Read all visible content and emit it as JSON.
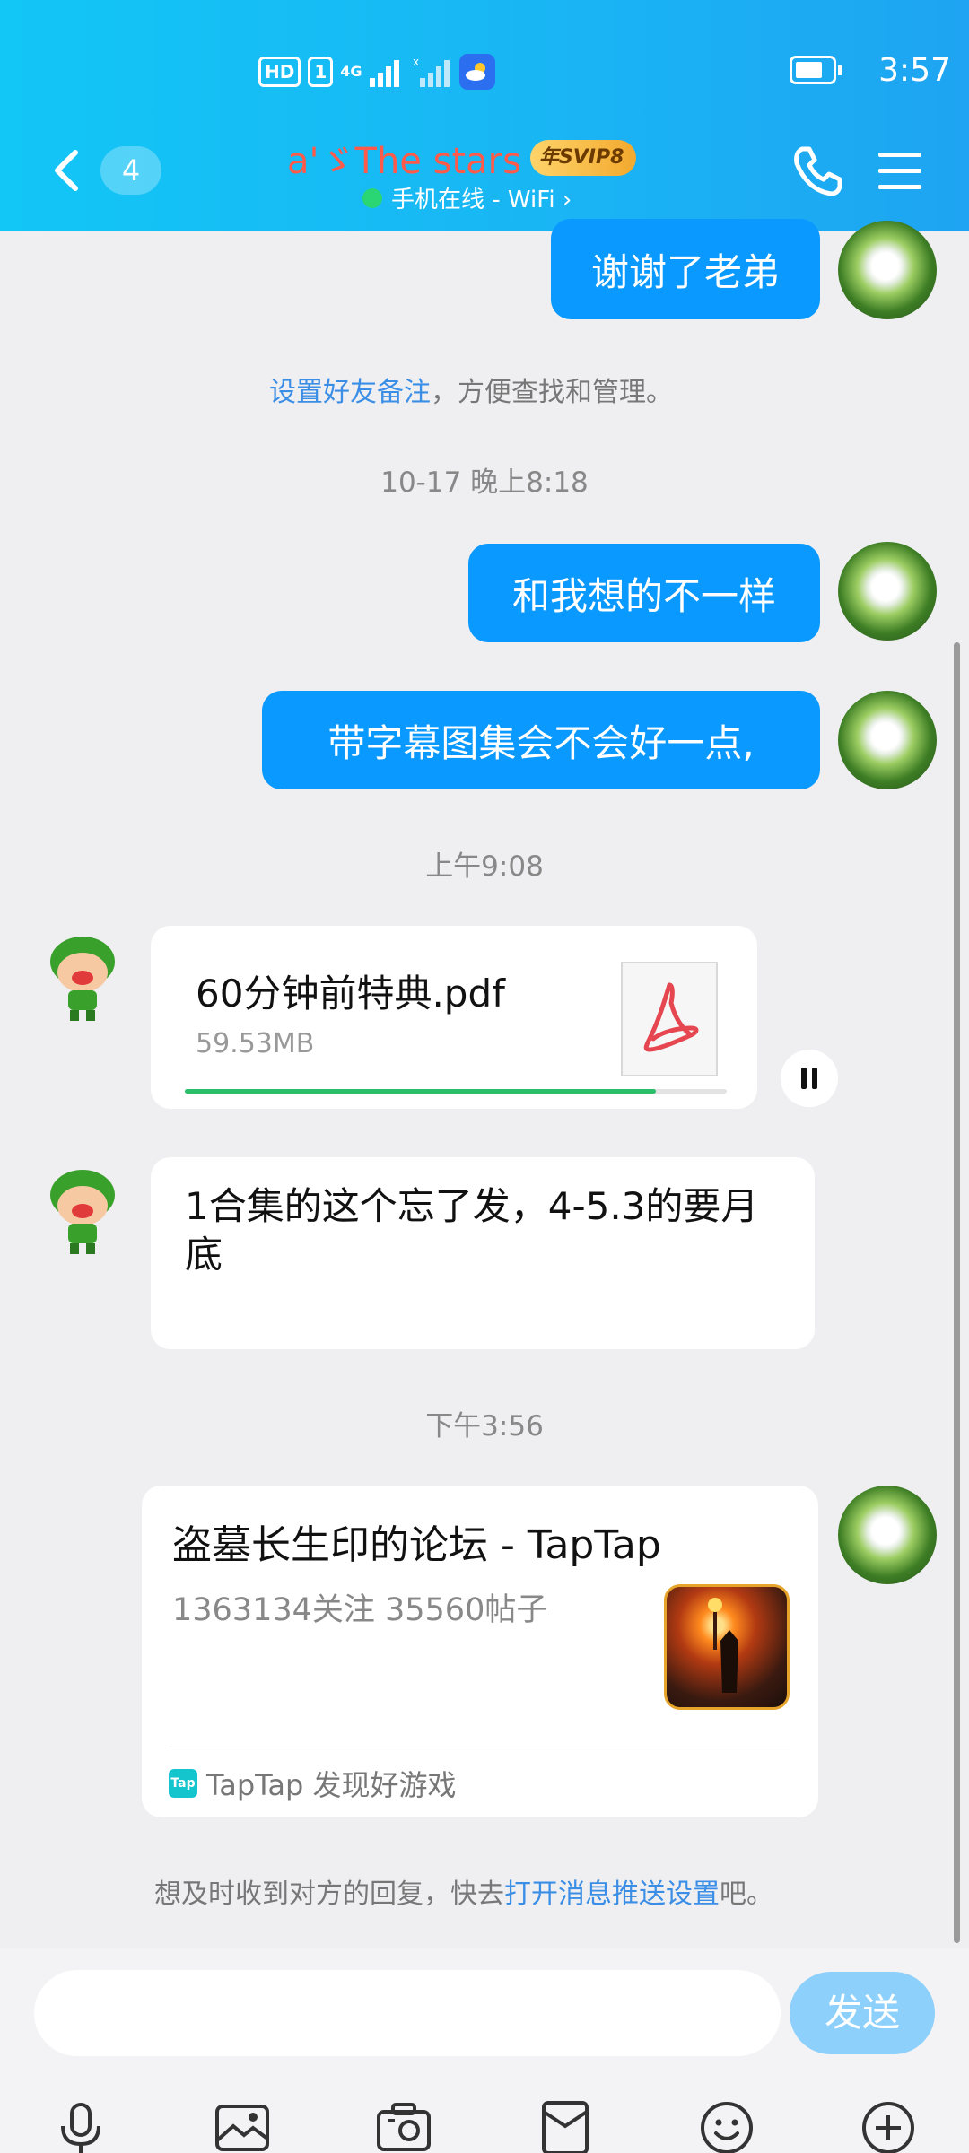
{
  "status_bar": {
    "hd_label": "HD",
    "sim_label": "1",
    "network_label": "4G",
    "time": "3:57",
    "icons": [
      "hd-icon",
      "sim-icon",
      "signal-icon",
      "signal-no-service-icon",
      "weather-icon",
      "battery-icon"
    ]
  },
  "header": {
    "unread_count": "4",
    "title": "a'ゞThe stars",
    "badge": "年SVIP8",
    "online_status": "手机在线 - WiFi ›",
    "icons": [
      "back-chevron-icon",
      "phone-icon",
      "menu-icon"
    ]
  },
  "chat": {
    "msg_thanks": "谢谢了老弟",
    "friend_note_link": "设置好友备注",
    "friend_note_rest": "，方便查找和管理。",
    "ts_1": "10-17 晚上8:18",
    "msg_different": "和我想的不一样",
    "msg_subtitles": "带字幕图集会不会好一点,",
    "ts_2": "上午9:08",
    "file": {
      "name": "60分钟前特典.pdf",
      "size": "59.53MB",
      "progress": 0.87,
      "icon": "pdf-icon"
    },
    "msg_collection": "1合集的这个忘了发，4-5.3的要月底",
    "ts_3": "下午3:56",
    "share": {
      "title": "盗墓长生印的论坛 - TapTap",
      "description": "1363134关注 35560帖子",
      "source_logo": "Tap",
      "source": "TapTap 发现好游戏"
    },
    "push_note_prefix": "想及时收到对方的回复，快去",
    "push_note_link": "打开消息推送设置",
    "push_note_suffix": "吧。"
  },
  "input": {
    "placeholder": "",
    "send_label": "发送",
    "toolbar_icons": [
      "microphone-icon",
      "image-icon",
      "camera-icon",
      "red-packet-icon",
      "emoji-icon",
      "plus-icon"
    ]
  },
  "colors": {
    "header_start": "#12c6f6",
    "header_end": "#1ea4f2",
    "bubble_blue": "#0a99ff",
    "link_blue": "#3b8ee6",
    "progress_green": "#2bbf6a",
    "send_button": "#8cd0fb"
  }
}
